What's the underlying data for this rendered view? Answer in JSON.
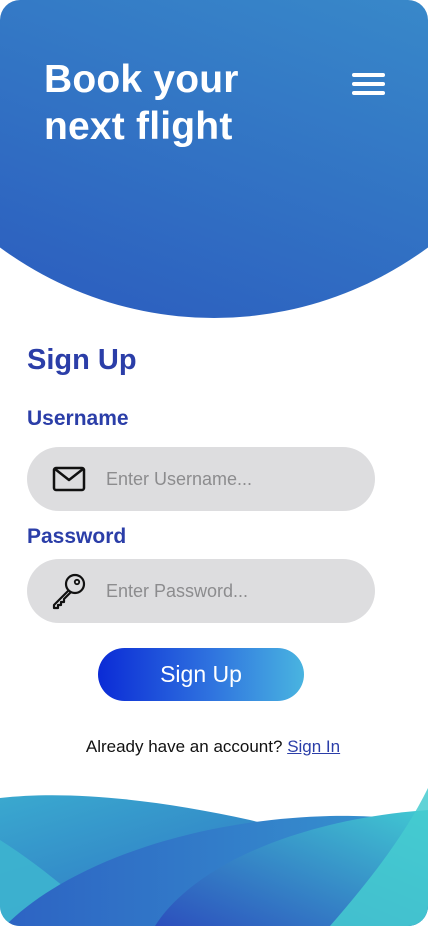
{
  "header": {
    "title": "Book your next flight",
    "menu_icon": "hamburger-menu-icon"
  },
  "form": {
    "title": "Sign Up",
    "username": {
      "label": "Username",
      "placeholder": "Enter Username...",
      "icon": "envelope-icon"
    },
    "password": {
      "label": "Password",
      "placeholder": "Enter Password...",
      "icon": "key-icon"
    },
    "submit_label": "Sign Up",
    "signin_prompt": "Already have an account?",
    "signin_link": "Sign In"
  },
  "colors": {
    "accent": "#2b3ea8",
    "header_gradient": [
      "#45b6cf",
      "#3a8fcb",
      "#2a57bd"
    ],
    "button_gradient": [
      "#0b2bd6",
      "#2f73df",
      "#49b4e0"
    ],
    "input_background": "#dddddf"
  }
}
